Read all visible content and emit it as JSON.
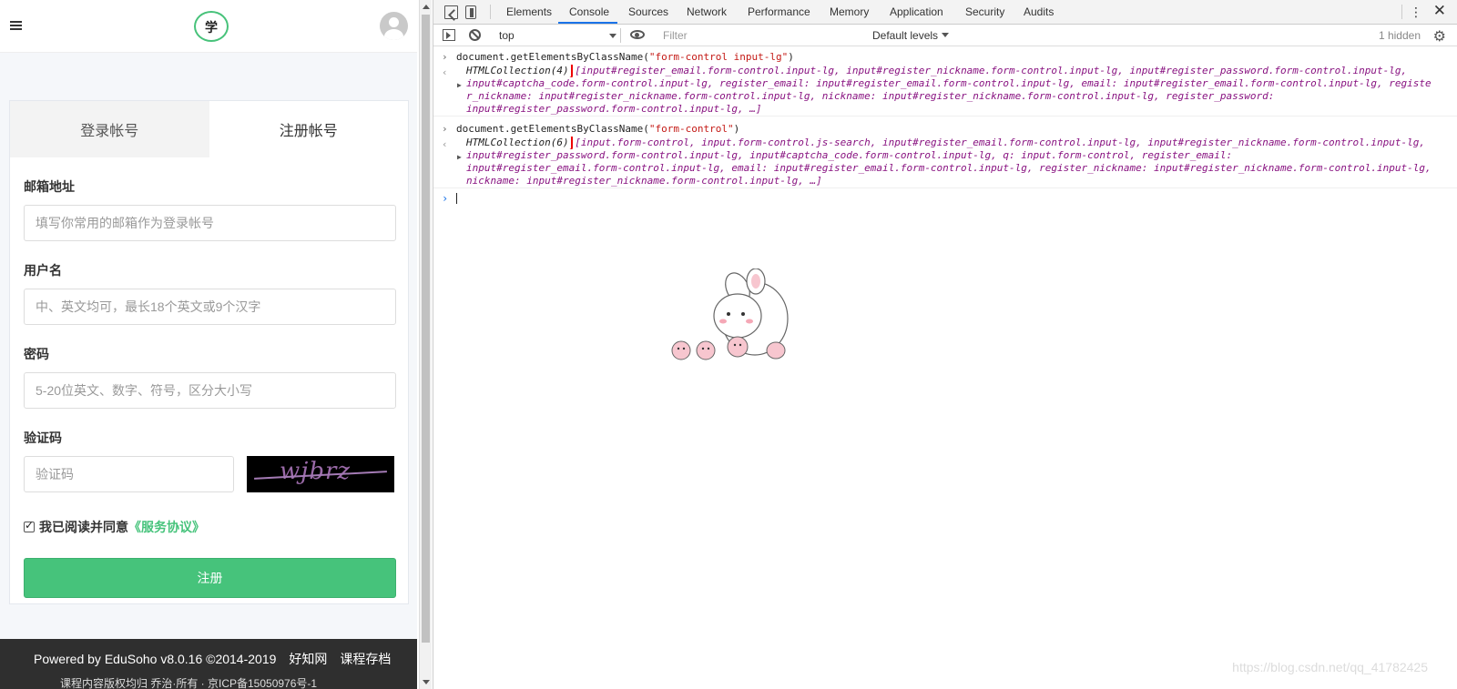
{
  "page": {
    "logo_text": "学",
    "tabs": {
      "login": "登录帐号",
      "register": "注册帐号"
    },
    "fields": {
      "email": {
        "label": "邮箱地址",
        "placeholder": "填写你常用的邮箱作为登录帐号"
      },
      "nickname": {
        "label": "用户名",
        "placeholder": "中、英文均可，最长18个英文或9个汉字"
      },
      "password": {
        "label": "密码",
        "placeholder": "5-20位英文、数字、符号，区分大小写"
      },
      "captcha": {
        "label": "验证码",
        "placeholder": "验证码",
        "image_text": "wjbrz"
      }
    },
    "agree": {
      "text": "我已阅读并同意",
      "link": "《服务协议》",
      "checked": true
    },
    "submit_label": "注册",
    "footer": {
      "powered": "Powered by EduSoho v8.0.16 ©2014-2019",
      "link1": "好知网",
      "link2": "课程存档",
      "line2": "课程内容版权均归 乔治·所有 · 京ICP备15050976号-1"
    }
  },
  "devtools": {
    "tabs": [
      "Elements",
      "Console",
      "Sources",
      "Network",
      "Performance",
      "Memory",
      "Application",
      "Security",
      "Audits"
    ],
    "active_tab": "Console",
    "context": "top",
    "filter_placeholder": "Filter",
    "levels": "Default levels",
    "hidden": "1 hidden",
    "entries": [
      {
        "command": "document.getElementsByClassName(",
        "command_arg": "\"form-control input-lg\"",
        "command_end": ")",
        "collection": "HTMLCollection(4)",
        "lines": [
          "[input#register_email.form-control.input-lg, input#register_nickname.form-control.input-lg, input#register_password.form-control.input-lg,",
          "input#captcha_code.form-control.input-lg, register_email: input#register_email.form-control.input-lg, email: input#register_email.form-control.input-lg, registe",
          "r_nickname: input#register_nickname.form-control.input-lg, nickname: input#register_nickname.form-control.input-lg, register_password:",
          "input#register_password.form-control.input-lg, …]"
        ]
      },
      {
        "command": "document.getElementsByClassName(",
        "command_arg": "\"form-control\"",
        "command_end": ")",
        "collection": "HTMLCollection(6)",
        "lines": [
          "[input.form-control, input.form-control.js-search, input#register_email.form-control.input-lg, input#register_nickname.form-control.input-lg,",
          "input#register_password.form-control.input-lg, input#captcha_code.form-control.input-lg, q: input.form-control, register_email:",
          "input#register_email.form-control.input-lg, email: input#register_email.form-control.input-lg, register_nickname: input#register_nickname.form-control.input-lg,",
          "nickname: input#register_nickname.form-control.input-lg, …]"
        ]
      }
    ]
  },
  "watermark": "https://blog.csdn.net/qq_41782425",
  "colors": {
    "accent": "#46c37b",
    "devtools_blue": "#1a73e8",
    "highlight_red": "#e00000"
  }
}
